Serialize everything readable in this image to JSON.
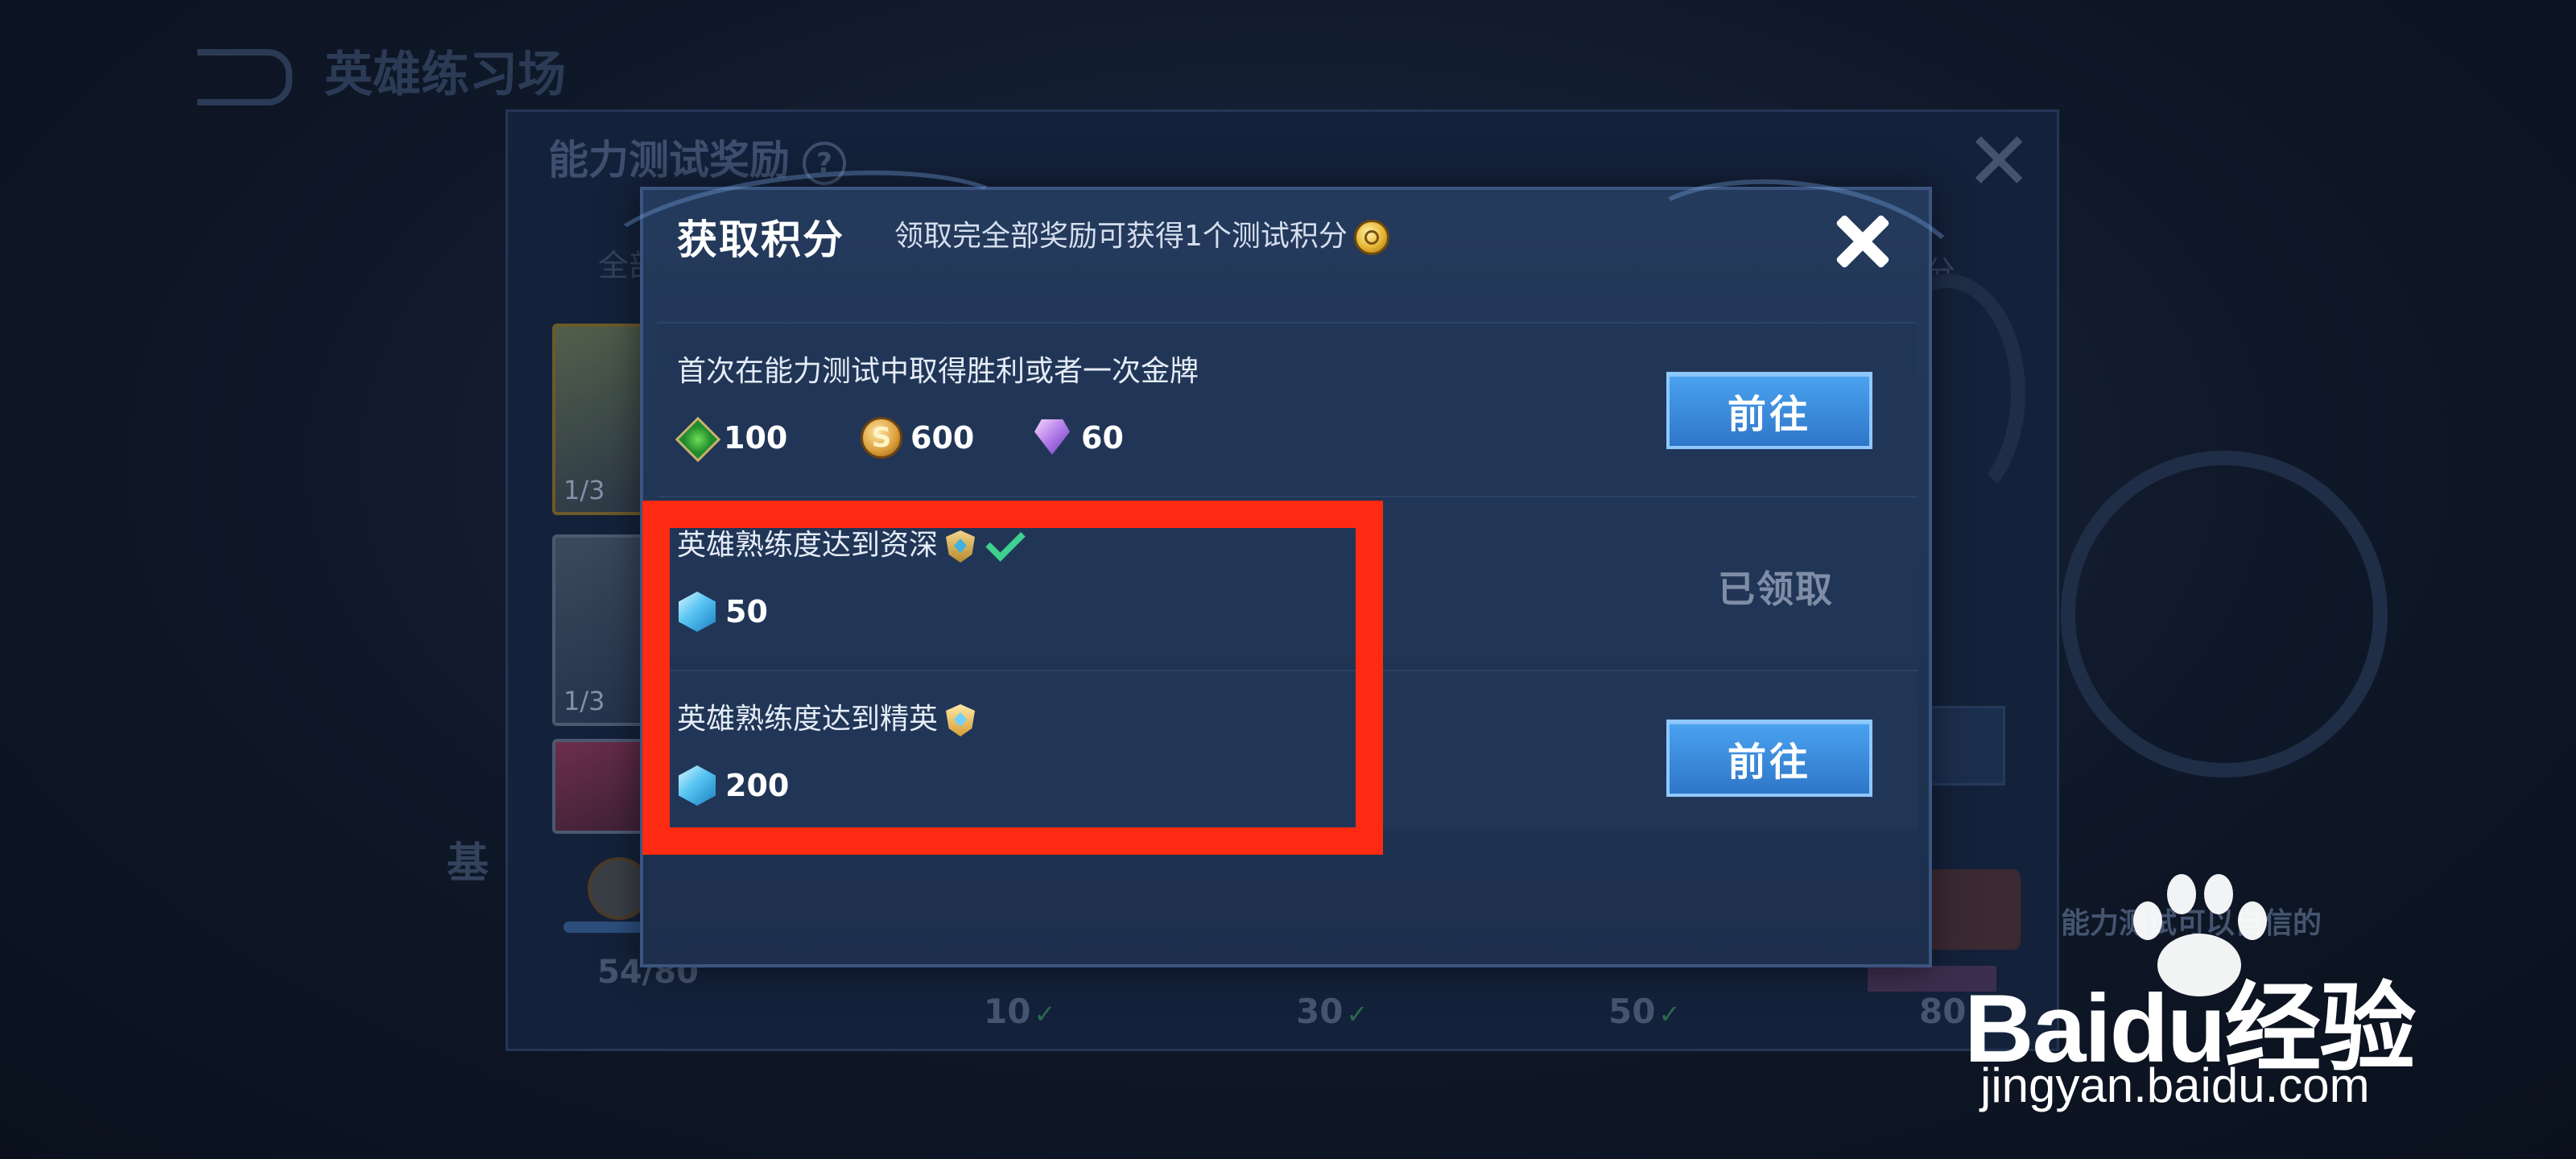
{
  "background": {
    "back_label": "英雄练习场",
    "panel_title": "能力测试奖励",
    "tab_left": "全部",
    "tab_right": "分",
    "card_counts": [
      "1/3",
      "1/3"
    ],
    "bottom_title": "基",
    "progress_text": "54/80",
    "progress_fraction": 0.675,
    "right_text": "能力测试可以自信的",
    "milestones": [
      "10",
      "30",
      "50",
      "80"
    ]
  },
  "dialog": {
    "title": "获取积分",
    "subtitle": "领取完全部奖励可获得1个测试积分",
    "tasks": [
      {
        "title": "首次在能力测试中取得胜利或者一次金牌",
        "rewards": [
          {
            "icon": "xp-icon",
            "value": "100"
          },
          {
            "icon": "gold-coin-icon",
            "value": "600"
          },
          {
            "icon": "gem-icon",
            "value": "60"
          }
        ],
        "action": "前往"
      },
      {
        "title": "英雄熟练度达到资深",
        "rewards": [
          {
            "icon": "ice-cube-icon",
            "value": "50"
          }
        ],
        "status": "已领取"
      },
      {
        "title": "英雄熟练度达到精英",
        "rewards": [
          {
            "icon": "ice-cube-icon",
            "value": "200"
          }
        ],
        "action": "前往"
      }
    ]
  },
  "watermark": {
    "logo": "Baidu经验",
    "url": "jingyan.baidu.com"
  },
  "colors": {
    "highlight": "#ff2a12",
    "button": "#3a8de0",
    "check": "#3fcf8e"
  }
}
